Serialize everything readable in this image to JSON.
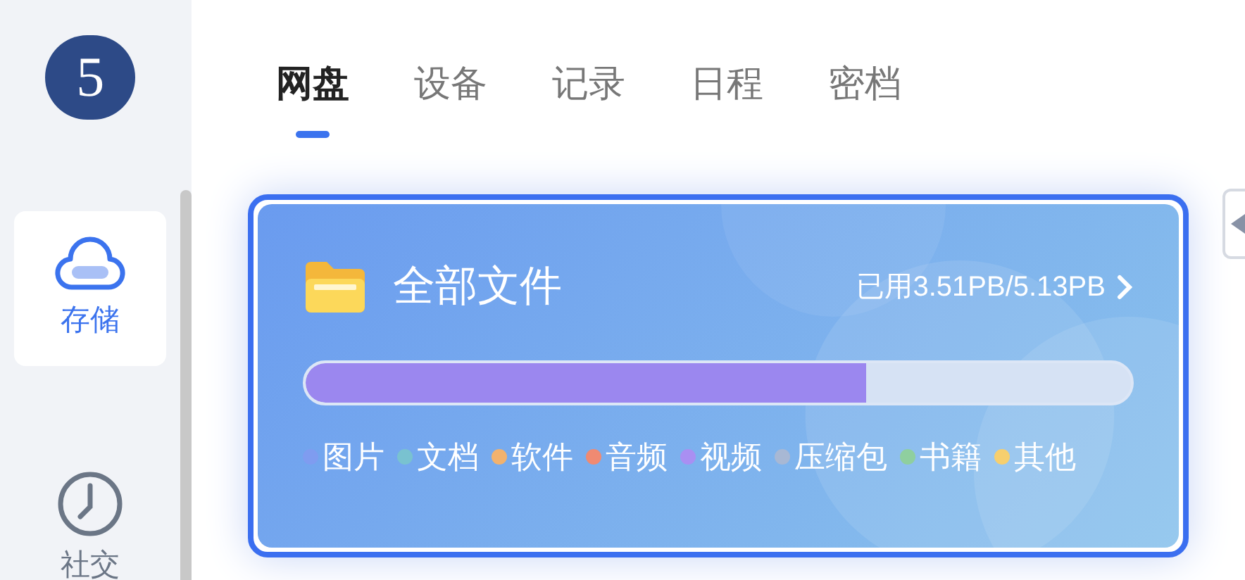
{
  "logo": "5",
  "sidebar": {
    "items": [
      {
        "label": "存储",
        "kind": "cloud",
        "selected": true
      },
      {
        "label": "社交",
        "kind": "clock",
        "selected": false
      }
    ]
  },
  "tabs": [
    {
      "label": "网盘",
      "selected": true
    },
    {
      "label": "设备",
      "selected": false
    },
    {
      "label": "记录",
      "selected": false
    },
    {
      "label": "日程",
      "selected": false
    },
    {
      "label": "密档",
      "selected": false
    }
  ],
  "card": {
    "title": "全部文件",
    "usage": "已用3.51PB/5.13PB",
    "level": 0.68,
    "legend": [
      {
        "label": "图片",
        "color": "#7f9cf0"
      },
      {
        "label": "文档",
        "color": "#79c2d0"
      },
      {
        "label": "软件",
        "color": "#f2b26e"
      },
      {
        "label": "音频",
        "color": "#f08a72"
      },
      {
        "label": "视频",
        "color": "#a98ff2"
      },
      {
        "label": "压缩包",
        "color": "#a8b8d4"
      },
      {
        "label": "书籍",
        "color": "#8fcf9f"
      },
      {
        "label": "其他",
        "color": "#f7cf6e"
      }
    ]
  }
}
